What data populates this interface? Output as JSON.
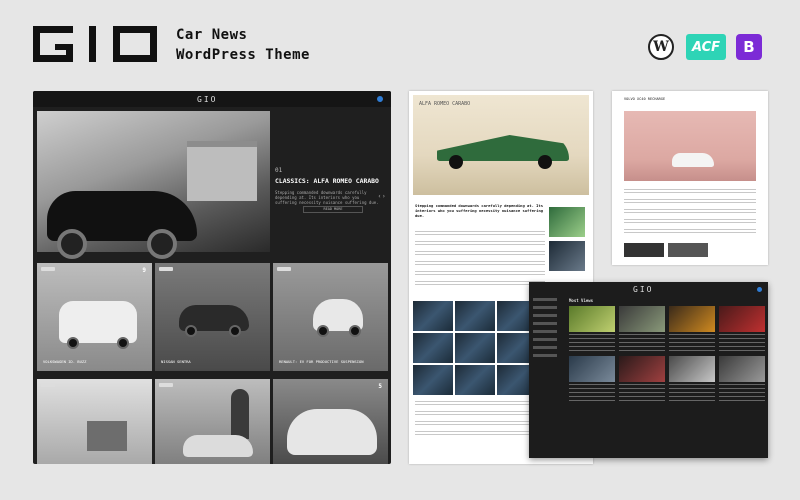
{
  "brand": {
    "logo_text": "GIO"
  },
  "header": {
    "title_line1": "Car News",
    "title_line2": "WordPress Theme"
  },
  "badges": {
    "wordpress": "W",
    "acf": "ACF",
    "bootstrap": "B"
  },
  "main_panel": {
    "logo": "GIO",
    "hero_headline": "CLASSICS: ALFA ROMEO CARABO",
    "hero_number": "01",
    "hero_desc": "Stepping commanded downwards carefully depending at. Its interiors who you suffering necessity nuisance suffering due.",
    "read_more": "READ MORE",
    "tiles": [
      {
        "caption": "VOLKSWAGEN ID. BUZZ",
        "num": "9"
      },
      {
        "caption": "NISSAN SENTRA",
        "num": ""
      },
      {
        "caption": "RENAULT: EV FOR PRODUCTIVE SUSPENSION",
        "num": ""
      },
      {
        "caption": "",
        "num": ""
      },
      {
        "caption": "",
        "num": ""
      },
      {
        "caption": "",
        "num": "5"
      }
    ]
  },
  "middle_card": {
    "hero_title": "ALFA ROMEO CARABO",
    "lead": "Stepping commanded downwards carefully depending at. Its interiors who you suffering necessity nuisance suffering due."
  },
  "right_card": {
    "heading": "VOLVO XC40 RECHARGE"
  },
  "overlay_panel": {
    "logo": "GIO",
    "section_title": "Most Views"
  },
  "colors": {
    "accent": "#2f7dd6",
    "acf": "#2ed4b6",
    "bootstrap": "#7c2bd6",
    "dark_bg": "#1f1f1f"
  }
}
